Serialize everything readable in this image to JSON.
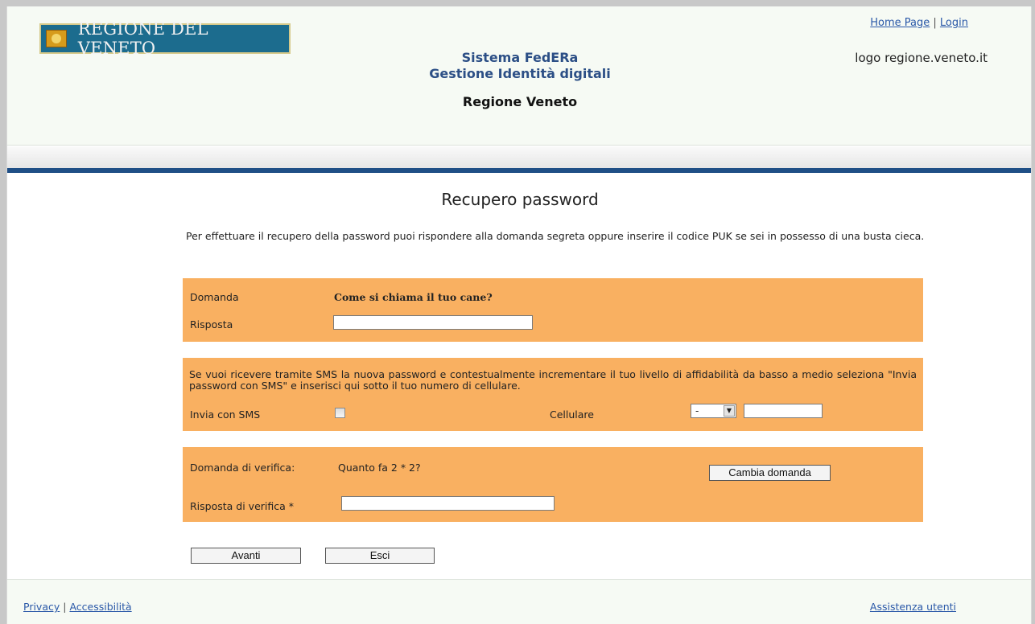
{
  "header": {
    "logo_text": "REGIONE DEL VENETO",
    "logo_alt": "logo regione.veneto.it",
    "system_line1": "Sistema FedERa",
    "system_line2": "Gestione Identità digitali",
    "region": "Regione Veneto",
    "links": {
      "home": "Home Page",
      "separator": "|",
      "login": "Login"
    }
  },
  "main": {
    "title": "Recupero password",
    "intro": "Per effettuare il recupero della password puoi rispondere alla domanda segreta oppure inserire il codice PUK se sei in possesso di una busta cieca.",
    "secret": {
      "question_label": "Domanda",
      "question_value": "Come si chiama il tuo cane?",
      "answer_label": "Risposta",
      "answer_value": ""
    },
    "sms": {
      "info": "Se vuoi ricevere tramite SMS la nuova password e contestualmente incrementare il tuo livello di affidabilità da basso a medio seleziona \"Invia password con SMS\" e inserisci qui sotto il tuo numero di cellulare.",
      "send_label": "Invia con SMS",
      "send_checked": false,
      "cell_label": "Cellulare",
      "prefix_selected": "-",
      "number_value": ""
    },
    "captcha": {
      "question_label": "Domanda di verifica:",
      "question_value": "Quanto fa 2 * 2?",
      "change_button": "Cambia domanda",
      "answer_label": "Risposta di verifica *",
      "answer_value": ""
    },
    "buttons": {
      "next": "Avanti",
      "exit": "Esci"
    }
  },
  "footer": {
    "privacy": "Privacy",
    "separator": "|",
    "accessibility": "Accessibilità",
    "support": "Assistenza utenti"
  },
  "colors": {
    "form_box": "#f9b061",
    "header_bg": "#f6faf4",
    "blue_band": "#1f4f86",
    "title_blue": "#2c4f86",
    "link": "#2a58a8"
  }
}
